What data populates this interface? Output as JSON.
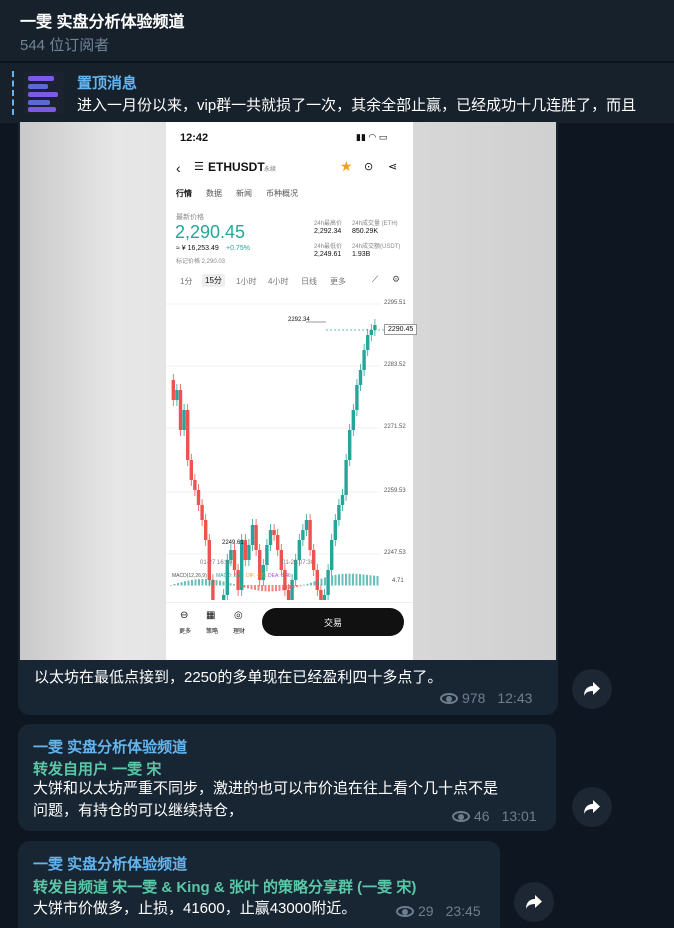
{
  "channel": {
    "title": "一雯 实盘分析体验频道",
    "subscribers": "544 位订阅者"
  },
  "pinned": {
    "title": "置顶消息",
    "text": "进入一月份以来，vip群一共就损了一次，其余全部止赢，已经成功十几连胜了，而且"
  },
  "messages": [
    {
      "text": "以太坊在最低点接到，2250的多单现在已经盈利四十多点了。",
      "views": "978",
      "time": "12:43",
      "screenshot": {
        "status_time": "12:42",
        "symbol": "ETHUSDT",
        "perp": "永续",
        "tabs": [
          "行情",
          "数据",
          "新闻",
          "币种概况"
        ],
        "price_label": "最新价格",
        "price": "2,290.45",
        "cny": "≈ ¥ 16,253.49",
        "change": "+0.75%",
        "mark_price": "标记价格 2,290.03",
        "stats": [
          {
            "label": "24h最高价",
            "value": "2,292.34"
          },
          {
            "label": "24h成交量 (ETH)",
            "value": "850.29K"
          },
          {
            "label": "24h最低价",
            "value": "2,249.61"
          },
          {
            "label": "24h成交额(USDT)",
            "value": "1.93B"
          }
        ],
        "intervals": [
          "1分",
          "15分",
          "1小时",
          "4小时",
          "日线",
          "更多"
        ],
        "y_ticks": [
          "2295.51",
          "2283.52",
          "2271.52",
          "2259.53",
          "2247.53"
        ],
        "hi_label": "2292.34",
        "lo_label": "2249.61",
        "last_label": "2290.45",
        "x_ticks": [
          "01-27 16:00",
          "01-28 07:30"
        ],
        "macd": "MACD(12,26,9)",
        "macd_v": "MACD: 2.55",
        "dif": "DIF: 4.71",
        "dea": "DEA: 3.46",
        "macd_right": "4.71",
        "nav": [
          "更多",
          "策略",
          "理财"
        ],
        "trade": "交易"
      }
    },
    {
      "channel": "一雯 实盘分析体验频道",
      "forward": "转发自用户 一雯 宋",
      "text1": "大饼和以太坊严重不同步，激进的也可以市价追在往上看个几十点不是",
      "text2": "问题，有持仓的可以继续持仓，",
      "views": "46",
      "time": "13:01"
    },
    {
      "channel": "一雯 实盘分析体验频道",
      "forward": "转发自频道 宋一雯 & King & 张叶 的策略分享群 (一雯 宋)",
      "text": "大饼市价做多，止损，41600，止赢43000附近。",
      "views": "29",
      "time": "23:45"
    }
  ],
  "colors": {
    "accent": "#64b5ef",
    "forward": "#5ac8a8",
    "up": "#26a69a",
    "down": "#ef5350"
  }
}
